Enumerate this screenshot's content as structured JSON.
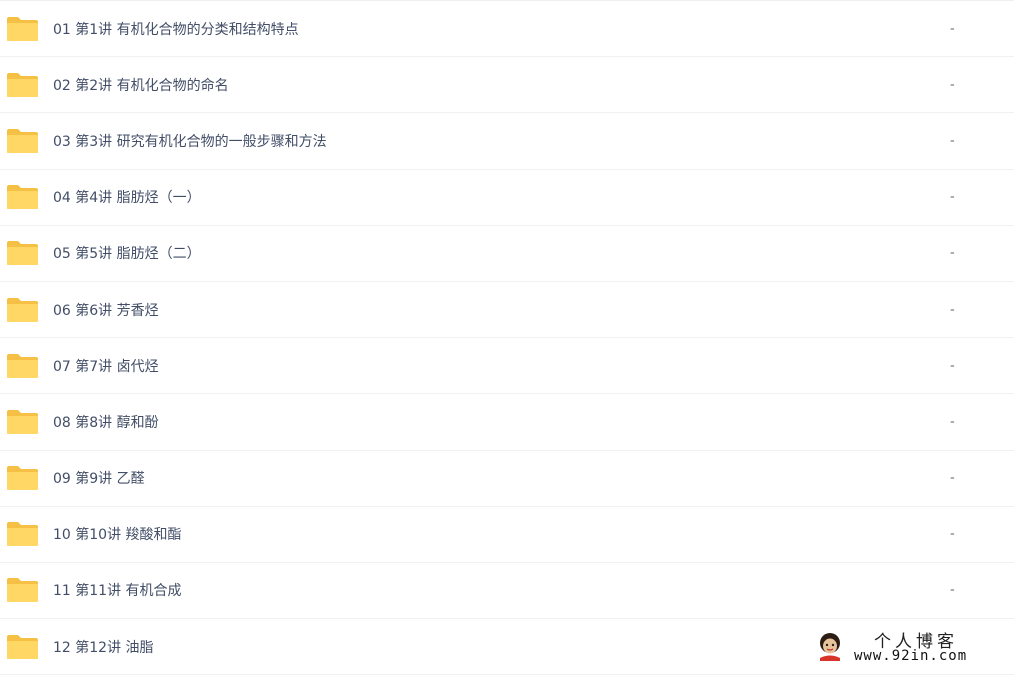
{
  "colors": {
    "folder_back": "#F5C044",
    "folder_front": "#FFD764",
    "text": "#424E67",
    "row_border": "#F0F1F3"
  },
  "files": [
    {
      "name": "01 第1讲 有机化合物的分类和结构特点",
      "size": "-",
      "icon": "folder-icon"
    },
    {
      "name": "02 第2讲 有机化合物的命名",
      "size": "-",
      "icon": "folder-icon"
    },
    {
      "name": "03 第3讲 研究有机化合物的一般步骤和方法",
      "size": "-",
      "icon": "folder-icon"
    },
    {
      "name": "04 第4讲 脂肪烃（一）",
      "size": "-",
      "icon": "folder-icon"
    },
    {
      "name": "05 第5讲 脂肪烃（二）",
      "size": "-",
      "icon": "folder-icon"
    },
    {
      "name": "06 第6讲 芳香烃",
      "size": "-",
      "icon": "folder-icon"
    },
    {
      "name": "07 第7讲 卤代烃",
      "size": "-",
      "icon": "folder-icon"
    },
    {
      "name": "08 第8讲 醇和酚",
      "size": "-",
      "icon": "folder-icon"
    },
    {
      "name": "09 第9讲 乙醛",
      "size": "-",
      "icon": "folder-icon"
    },
    {
      "name": "10 第10讲 羧酸和酯",
      "size": "-",
      "icon": "folder-icon"
    },
    {
      "name": "11 第11讲 有机合成",
      "size": "-",
      "icon": "folder-icon"
    },
    {
      "name": "12 第12讲 油脂",
      "size": "",
      "icon": "folder-icon"
    }
  ],
  "watermark": {
    "title": "个人博客",
    "url": "www.92in.com"
  }
}
